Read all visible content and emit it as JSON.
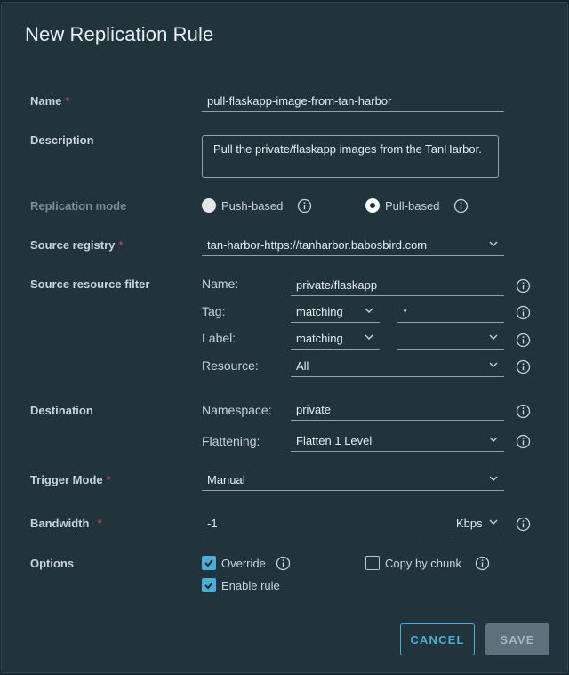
{
  "dialog": {
    "title": "New Replication Rule"
  },
  "name": {
    "label": "Name",
    "required": "*",
    "value": "pull-flaskapp-image-from-tan-harbor"
  },
  "description": {
    "label": "Description",
    "value": "Pull the private/flaskapp images from the TanHarbor."
  },
  "replication_mode": {
    "label": "Replication mode",
    "options": [
      "Push-based",
      "Pull-based"
    ],
    "selected": "Pull-based"
  },
  "source_registry": {
    "label": "Source registry",
    "required": "*",
    "value": "tan-harbor-https://tanharbor.babosbird.com"
  },
  "source_filter": {
    "label": "Source resource filter",
    "name_label": "Name:",
    "name_value": "private/flaskapp",
    "tag_label": "Tag:",
    "tag_match": "matching",
    "tag_value": "*",
    "label_label": "Label:",
    "label_match": "matching",
    "label_value": "",
    "resource_label": "Resource:",
    "resource_value": "All"
  },
  "destination": {
    "label": "Destination",
    "namespace_label": "Namespace:",
    "namespace_value": "private",
    "flattening_label": "Flattening:",
    "flattening_value": "Flatten 1 Level"
  },
  "trigger": {
    "label": "Trigger Mode",
    "required": "*",
    "value": "Manual"
  },
  "bandwidth": {
    "label": "Bandwidth",
    "required": "*",
    "value": "-1",
    "unit": "Kbps"
  },
  "options": {
    "label": "Options",
    "override_label": "Override",
    "override_checked": true,
    "copy_by_chunk_label": "Copy by chunk",
    "copy_by_chunk_checked": false,
    "enable_rule_label": "Enable rule",
    "enable_rule_checked": true
  },
  "buttons": {
    "cancel": "CANCEL",
    "save": "SAVE"
  },
  "colors": {
    "accent": "#49afd9",
    "required": "#e14f4f",
    "background": "#21333b"
  },
  "icons": {
    "info": "info-icon",
    "dropdown": "chevron-down-icon",
    "check": "check-icon"
  }
}
